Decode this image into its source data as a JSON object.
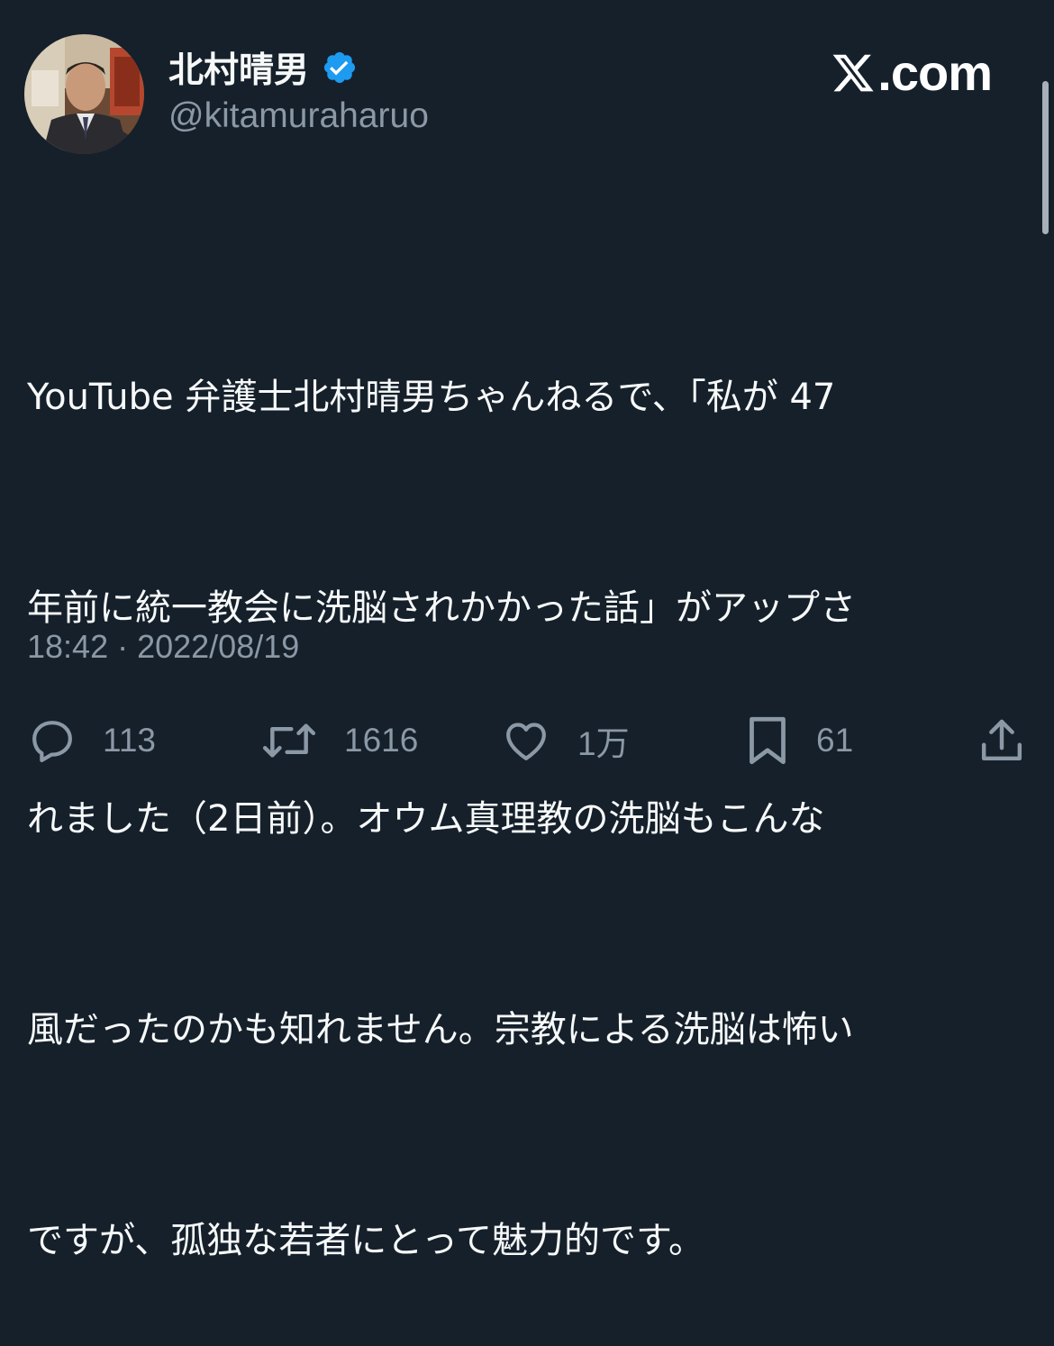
{
  "author": {
    "display_name": "北村晴男",
    "handle": "@kitamuraharuo",
    "verified": true,
    "verified_color": "#1d9bf0"
  },
  "brand": {
    "suffix": ".com"
  },
  "tweet": {
    "lines": [
      "YouTube 弁護士北村晴男ちゃんねるで、「私が 47",
      "年前に統一教会に洗脳されかかった話」がアップさ",
      "れました（2日前）。オウム真理教の洗脳もこんな",
      "風だったのかも知れません。宗教による洗脳は怖い",
      "ですが、孤独な若者にとって魅力的です。"
    ],
    "timestamp": "18:42 · 2022/08/19"
  },
  "actions": {
    "reply": {
      "icon": "reply-icon",
      "count": "113"
    },
    "retweet": {
      "icon": "retweet-icon",
      "count": "1616"
    },
    "like": {
      "icon": "like-icon",
      "count": "1万"
    },
    "bookmark": {
      "icon": "bookmark-icon",
      "count": "61"
    },
    "share": {
      "icon": "share-icon"
    }
  },
  "colors": {
    "background": "#15202b",
    "text": "#f7f9f9",
    "secondary_text": "#8b98a5"
  }
}
